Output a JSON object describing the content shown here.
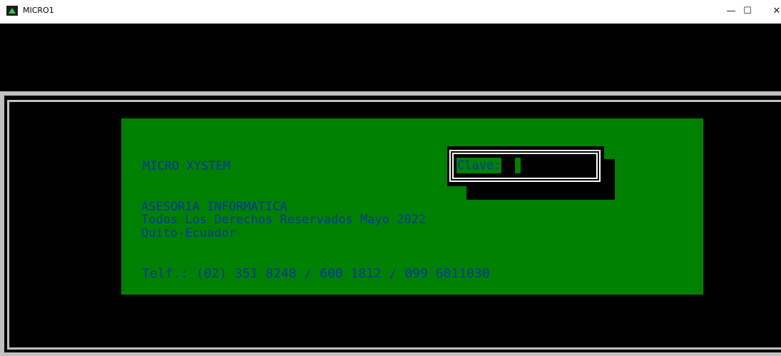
{
  "window": {
    "title": "MICRO1",
    "minimize_glyph": "—",
    "maximize_glyph": "☐",
    "close_glyph": "✕",
    "icon": "app-icon"
  },
  "screen": {
    "system_name": "MICRO XYSTEM",
    "company": "ASESORIA INFORMATICA",
    "rights": "Todos Los Derechos Reservados Mayo 2022",
    "location": "Quito-Ecuador",
    "phones": "Telf.: (02) 351 8248 / 600 1812 / 099 6011030"
  },
  "login": {
    "password_label": "Clave:",
    "password_value": ""
  },
  "colors": {
    "panel": "#008000",
    "text": "#00369b",
    "console": "#000000",
    "frame": "#c0c0c0"
  }
}
